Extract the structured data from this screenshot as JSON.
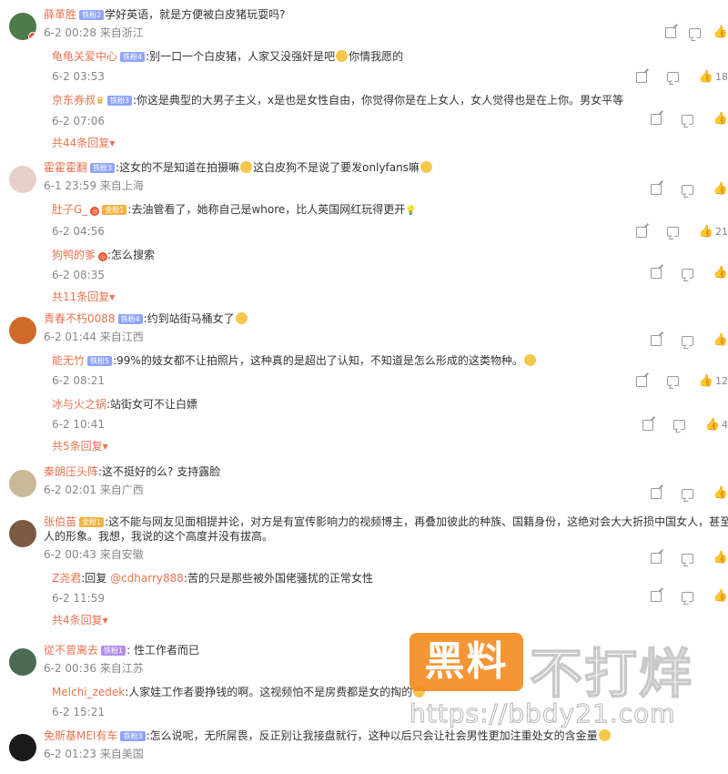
{
  "threads": [
    {
      "avatar_color": "#4e7a4c",
      "name": "薛革胜",
      "level": "铁粉2",
      "level_style": "blue",
      "verified": true,
      "text": "学好英语，就是方便被白皮猪玩耍吗?",
      "emoji": false,
      "meta": "6-2 00:28 来自浙江",
      "replies": [
        {
          "name": "龟龟关爱中心",
          "level": "铁粉4",
          "text": ":别一口一个白皮猪，人家又没强奸是吧",
          "emoji_mid": true,
          "text2": "你情我愿的",
          "meta": "6-2 03:53",
          "like_count": "18"
        },
        {
          "name": "京东券叔",
          "crown": true,
          "level": "铁粉3",
          "text": ":你这是典型的大男子主义，x是也是女性自由，你觉得你是在上女人，女人觉得也是在上你。男女平等",
          "meta": "6-2 07:06",
          "like_count": ""
        }
      ],
      "more": "共44条回复"
    },
    {
      "avatar_color": "#e8d0c8",
      "name": "霍霍霍翻",
      "level": "铁粉3",
      "level_style": "blue",
      "text": ":这女的不是知道在拍摄嘛",
      "emoji_mid": true,
      "text2": "这白皮狗不是说了要发onlyfans嘛",
      "emoji": true,
      "meta": "6-1 23:59 来自上海",
      "replies": [
        {
          "name": "肚子G_",
          "redo": true,
          "level": "金粉1",
          "gold": true,
          "text": ":去油管看了，她称自己是whore，比人英国网红玩得更开",
          "bulb": true,
          "meta": "6-2 04:56",
          "like_count": "21"
        },
        {
          "name": "狗鸭的爹",
          "redo": true,
          "text": ":怎么搜索",
          "meta": "6-2 08:35",
          "like_count": ""
        }
      ],
      "more": "共11条回复"
    },
    {
      "avatar_color": "#d06a2a",
      "name": "青春不朽0088",
      "level": "铁粉4",
      "level_style": "blue",
      "text": ":约到站街马桶女了",
      "emoji": true,
      "meta": "6-2 01:44 来自江西",
      "replies": [
        {
          "name": "能无竹",
          "level": "铁粉5",
          "text": ":99%的妓女都不让拍照片，这种真的是超出了认知，不知道是怎么形成的这类物种。",
          "emoji": true,
          "meta": "6-2 08:21",
          "like_count": "12"
        },
        {
          "name": "冰与火之锅",
          "text": ":站街女可不让白嫖",
          "meta": "6-2 10:41",
          "like_count": "4"
        }
      ],
      "more": "共5条回复"
    },
    {
      "avatar_color": "#c9b99a",
      "name": "秦朗压头阵",
      "text": ":这不挺好的么? 支持露脸",
      "meta": "6-2 02:01 来自广西",
      "replies": [],
      "more": ""
    },
    {
      "avatar_color": "#7b5a44",
      "name": "张伯苗",
      "level": "金粉1",
      "level_style": "gold",
      "text": ":这不能与网友见面相提并论，对方是有宣传影响力的视频博主，再叠加彼此的种族、国籍身份，这绝对会大大折损中国女人，甚至中国",
      "text_line2": "人的形象。我想，我说的这个高度并没有拔高。",
      "meta": "6-2 00:43 来自安徽",
      "replies": [
        {
          "name": "Z尧君",
          "text_reply_prefix": ":回复 ",
          "reply_to": "@cdharry888",
          "text": ":苦的只是那些被外国佬骚扰的正常女性",
          "meta": "6-2 11:59",
          "like_count": ""
        }
      ],
      "more": "共4条回复"
    },
    {
      "avatar_color": "#4f6a52",
      "name": "從不曾离去",
      "level": "铁粉1",
      "level_style": "purple",
      "text": ": 性工作者而已",
      "meta": "6-2 00:36 来自江苏",
      "replies": [
        {
          "name": "Melchi_zedek",
          "text": ":人家娃工作者要挣钱的啊。这视频怕不是房费都是女的掏的",
          "emoji": true,
          "meta": "6-2 15:21",
          "like_count": ""
        }
      ],
      "more": ""
    },
    {
      "avatar_color": "#1a1a1a",
      "name": "免斯基MEI有车",
      "level": "铁粉3",
      "level_style": "blue",
      "text": ":怎么说呢，无所屌畏，反正别让我接盘就行，这种以后只会让社会男性更加注重处女的含金量",
      "emoji": true,
      "meta": "6-2 01:23 来自美国",
      "replies": [],
      "more": ""
    }
  ],
  "watermark": {
    "box": "黑料",
    "rest": "不打烊",
    "url": "https://bbdy21.com"
  }
}
